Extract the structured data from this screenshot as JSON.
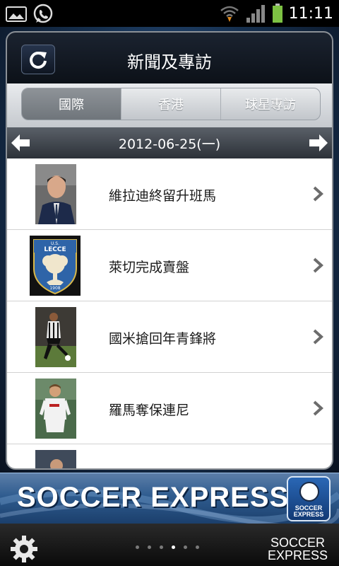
{
  "status_bar": {
    "time": "11:11",
    "icons": [
      "gallery-icon",
      "whatsapp-icon",
      "wifi-icon",
      "signal-icon",
      "battery-icon"
    ]
  },
  "header": {
    "title": "新聞及專訪",
    "refresh_icon": "refresh-icon"
  },
  "tabs": [
    {
      "label": "國際",
      "active": true
    },
    {
      "label": "香港",
      "active": false
    },
    {
      "label": "球星專訪",
      "active": false
    }
  ],
  "date_bar": {
    "date": "2012-06-25(一)"
  },
  "articles": [
    {
      "title": "維拉迪終留升班馬"
    },
    {
      "title": "萊切完成賣盤",
      "logo_text": "U.S. LECCE 1908"
    },
    {
      "title": "國米搶回年青鋒將"
    },
    {
      "title": "羅馬奪保連尼"
    }
  ],
  "banner": {
    "title": "SOCCER EXPRESS",
    "logo_text": "SOCCER EXPRESS"
  },
  "bottom_bar": {
    "brand_line1": "SOCCER",
    "brand_line2": "EXPRESS",
    "page_count": 6,
    "active_page": 4
  },
  "colors": {
    "header_bg": "#0c1118",
    "tab_active": "#7d8288",
    "date_bar": "#3a4048",
    "banner": "#2f5c8f",
    "battery": "#7dc243"
  }
}
